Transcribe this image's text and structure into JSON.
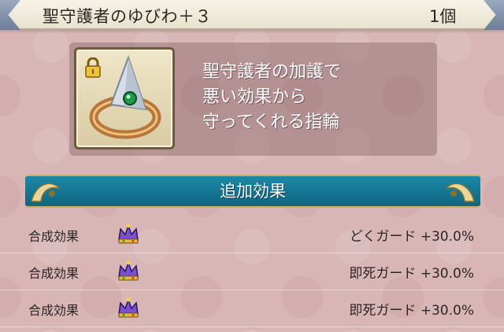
{
  "header": {
    "item_name": "聖守護者のゆびわ＋３",
    "count": "1個"
  },
  "item": {
    "icon": "ring-icon",
    "locked_icon": "lock-icon",
    "description_lines": [
      "聖守護者の加護で",
      "悪い効果から",
      "守ってくれる指輪"
    ]
  },
  "section": {
    "title": "追加効果"
  },
  "effects": [
    {
      "kind": "合成効果",
      "icon": "crown-icon",
      "name": "どくガード",
      "value": "+30.0%"
    },
    {
      "kind": "合成効果",
      "icon": "crown-icon",
      "name": "即死ガード",
      "value": "+30.0%"
    },
    {
      "kind": "合成効果",
      "icon": "crown-icon",
      "name": "即死ガード",
      "value": "+30.0%"
    }
  ],
  "colors": {
    "background": "#d8b6b6",
    "banner": "#1c87a7",
    "header": "#f3eee0"
  }
}
